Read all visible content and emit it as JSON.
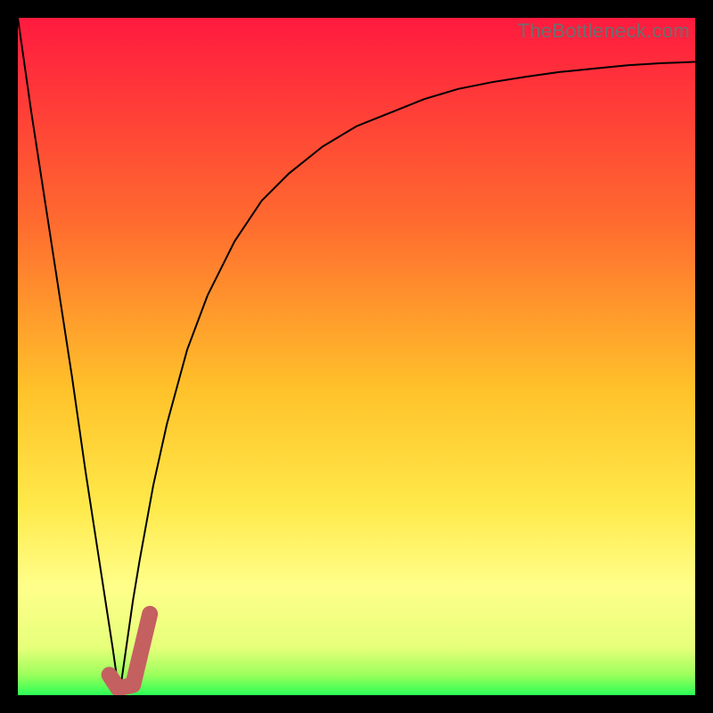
{
  "watermark": {
    "text": "TheBottleneck.com"
  },
  "chart_data": {
    "type": "line",
    "title": "",
    "xlabel": "",
    "ylabel": "",
    "xlim": [
      0,
      100
    ],
    "ylim": [
      0,
      100
    ],
    "gradient_stops": [
      {
        "offset": 0,
        "color": "#ff1a3f"
      },
      {
        "offset": 30,
        "color": "#ff6a2f"
      },
      {
        "offset": 55,
        "color": "#ffc22a"
      },
      {
        "offset": 72,
        "color": "#ffe94a"
      },
      {
        "offset": 84,
        "color": "#ffff8a"
      },
      {
        "offset": 93,
        "color": "#e6ff7a"
      },
      {
        "offset": 97,
        "color": "#9cff5c"
      },
      {
        "offset": 100,
        "color": "#2bff55"
      }
    ],
    "series": [
      {
        "name": "left-descent",
        "x": [
          0,
          2,
          4,
          6,
          8,
          10,
          12,
          14,
          15
        ],
        "values": [
          100,
          86,
          73,
          60,
          47,
          33,
          20,
          7,
          0
        ]
      },
      {
        "name": "right-curve",
        "x": [
          15,
          16,
          17,
          18,
          20,
          22,
          25,
          28,
          32,
          36,
          40,
          45,
          50,
          55,
          60,
          65,
          70,
          75,
          80,
          85,
          90,
          95,
          100
        ],
        "values": [
          0,
          7,
          14,
          20,
          31,
          40,
          51,
          59,
          67,
          73,
          77,
          81,
          84,
          86,
          88,
          89.5,
          90.5,
          91.3,
          92,
          92.5,
          93,
          93.3,
          93.5
        ]
      }
    ],
    "marker": {
      "name": "j-hook",
      "color": "#c46060",
      "points": [
        {
          "x": 13.5,
          "y": 3
        },
        {
          "x": 14.8,
          "y": 1
        },
        {
          "x": 17.0,
          "y": 1.5
        },
        {
          "x": 19.5,
          "y": 12
        }
      ]
    }
  }
}
